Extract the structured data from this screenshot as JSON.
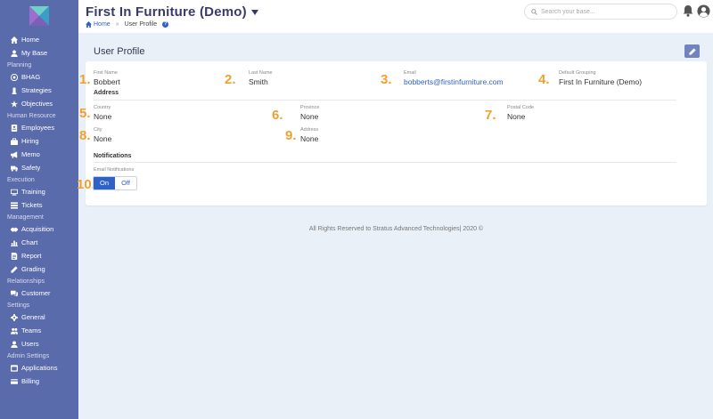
{
  "sidebar": {
    "groups": [
      {
        "label": "",
        "items": [
          {
            "label": "Home",
            "icon": "home-icon"
          },
          {
            "label": "My Base",
            "icon": "user-icon"
          }
        ]
      },
      {
        "label": "Planning",
        "items": [
          {
            "label": "BHAG",
            "icon": "target-icon"
          },
          {
            "label": "Strategies",
            "icon": "chess-icon"
          },
          {
            "label": "Objectives",
            "icon": "star-icon"
          }
        ]
      },
      {
        "label": "Human Resource",
        "items": [
          {
            "label": "Employees",
            "icon": "id-card-icon"
          },
          {
            "label": "Hiring",
            "icon": "briefcase-icon"
          },
          {
            "label": "Memo",
            "icon": "megaphone-icon"
          },
          {
            "label": "Safety",
            "icon": "truck-icon"
          }
        ]
      },
      {
        "label": "Execution",
        "items": [
          {
            "label": "Training",
            "icon": "chalkboard-icon"
          },
          {
            "label": "Tickets",
            "icon": "list-icon"
          }
        ]
      },
      {
        "label": "Management",
        "items": [
          {
            "label": "Acquisition",
            "icon": "handshake-icon"
          },
          {
            "label": "Chart",
            "icon": "chart-icon"
          },
          {
            "label": "Report",
            "icon": "report-icon"
          },
          {
            "label": "Grading",
            "icon": "pencil-icon"
          }
        ]
      },
      {
        "label": "Relationships",
        "items": [
          {
            "label": "Customer",
            "icon": "comments-icon"
          }
        ]
      },
      {
        "label": "Settings",
        "items": [
          {
            "label": "General",
            "icon": "gear-icon"
          },
          {
            "label": "Teams",
            "icon": "users-icon"
          },
          {
            "label": "Users",
            "icon": "user-icon"
          }
        ]
      },
      {
        "label": "Admin Settings",
        "items": [
          {
            "label": "Applications",
            "icon": "apps-icon"
          },
          {
            "label": "Billing",
            "icon": "credit-card-icon"
          }
        ]
      }
    ]
  },
  "header": {
    "title": "First In Furniture (Demo)",
    "breadcrumb": {
      "home": "Home",
      "separator": "»",
      "current": "User Profile",
      "help": "?"
    },
    "search_placeholder": "Search your base..."
  },
  "profile": {
    "title": "User Profile",
    "first_name": {
      "label": "First Name",
      "value": "Bobbert",
      "marker": "1."
    },
    "last_name": {
      "label": "Last Name",
      "value": "Smith",
      "marker": "2."
    },
    "email": {
      "label": "Email",
      "value": "bobberts@firstinfurniture.com",
      "marker": "3."
    },
    "default_grouping": {
      "label": "Default Grouping",
      "value": "First In Furniture (Demo)",
      "marker": "4."
    },
    "address_heading": "Address",
    "country": {
      "label": "Country",
      "value": "None",
      "marker": "5."
    },
    "province": {
      "label": "Province",
      "value": "None",
      "marker": "6."
    },
    "postal_code": {
      "label": "Postal Code",
      "value": "None",
      "marker": "7."
    },
    "city": {
      "label": "City",
      "value": "None",
      "marker": "8."
    },
    "address": {
      "label": "Address",
      "value": "None",
      "marker": "9."
    },
    "notifications_heading": "Notifications",
    "email_notifications": {
      "label": "Email Notifications",
      "on": "On",
      "off": "Off",
      "selected": "On",
      "marker": "10."
    }
  },
  "footer": "All Rights Reserved to Stratus Advanced Technologies| 2020 ©",
  "colors": {
    "sidebar": "#5a6bab",
    "accent": "#2f62c6",
    "marker": "#f0a030",
    "background": "#e9f0f8"
  }
}
